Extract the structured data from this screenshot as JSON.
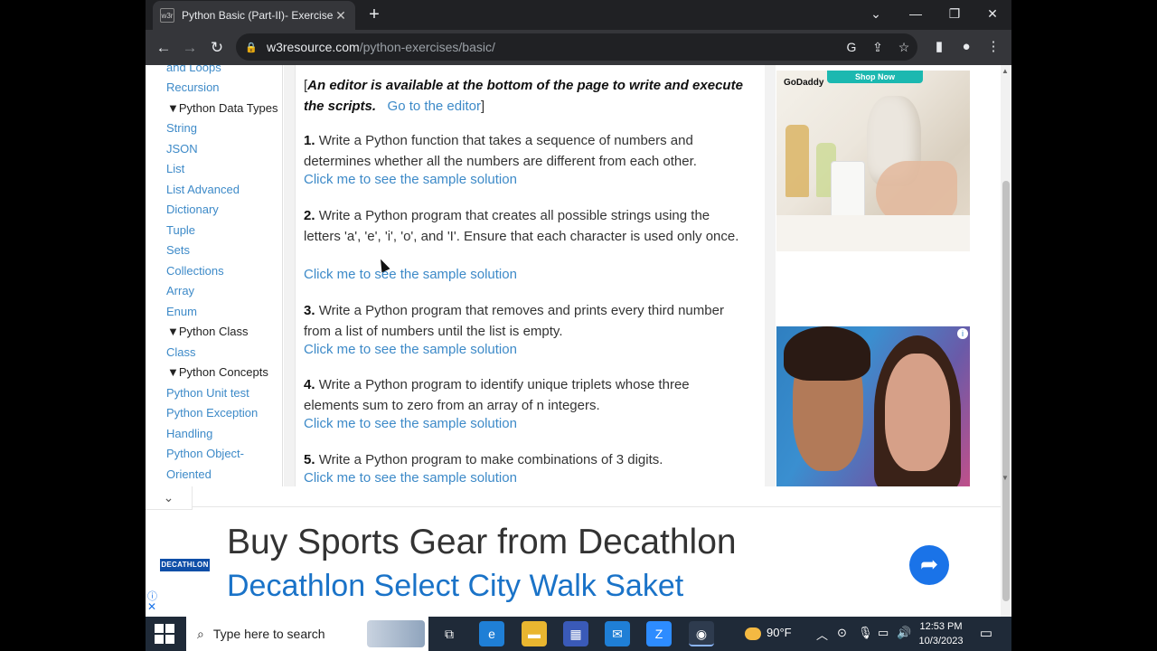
{
  "browser": {
    "tab": {
      "favicon_text": "w3r",
      "title": "Python Basic (Part-II)- Exercises,",
      "close": "✕"
    },
    "new_tab": "+",
    "window": {
      "dropdown": "⌄",
      "minimize": "—",
      "restore": "❐",
      "close": "✕"
    },
    "nav": {
      "back": "←",
      "forward": "→",
      "reload": "↻"
    },
    "address": {
      "host": "w3resource.com",
      "path": "/python-exercises/basic/"
    }
  },
  "sidebar": {
    "partial_top": "and Loops",
    "items": [
      {
        "label": "Recursion",
        "type": "link"
      },
      {
        "label": "▼Python Data Types",
        "type": "head"
      },
      {
        "label": "String",
        "type": "link"
      },
      {
        "label": "JSON",
        "type": "link"
      },
      {
        "label": "List",
        "type": "link"
      },
      {
        "label": "List Advanced",
        "type": "link"
      },
      {
        "label": "Dictionary",
        "type": "link"
      },
      {
        "label": "Tuple",
        "type": "link"
      },
      {
        "label": "Sets",
        "type": "link"
      },
      {
        "label": "Collections",
        "type": "link"
      },
      {
        "label": "Array",
        "type": "link"
      },
      {
        "label": "Enum",
        "type": "link"
      },
      {
        "label": "▼Python Class",
        "type": "head"
      },
      {
        "label": "Class",
        "type": "link"
      },
      {
        "label": "▼Python Concepts",
        "type": "head"
      },
      {
        "label": "Python Unit test",
        "type": "link"
      },
      {
        "label": "Python Exception",
        "type": "link"
      },
      {
        "label": "Handling",
        "type": "link"
      },
      {
        "label": "Python Object-",
        "type": "link"
      },
      {
        "label": "Oriented",
        "type": "link"
      }
    ]
  },
  "article": {
    "intro_open": "[",
    "intro_bold": "An editor is available at the bottom of the page to write and execute the scripts.",
    "intro_link": "Go to the editor",
    "intro_close": "]",
    "solution_label": "Click me to see the sample solution",
    "exercises": [
      {
        "num": "1.",
        "text": "Write a Python function that takes a sequence of numbers and determines whether all the numbers are different from each other."
      },
      {
        "num": "2.",
        "text": "Write a Python program that creates all possible strings using the letters 'a', 'e', 'i', 'o', and 'I'. Ensure that each character is used only once."
      },
      {
        "num": "3.",
        "text": "Write a Python program that removes and prints every third number from a list of numbers until the list is empty."
      },
      {
        "num": "4.",
        "text": "Write a Python program to identify unique triplets whose three elements sum to zero from an array of n integers."
      },
      {
        "num": "5.",
        "text": "Write a Python program to make combinations of 3 digits."
      }
    ],
    "back_to_top": "↑"
  },
  "ads": {
    "side_top": {
      "button": "Shop Now",
      "brand": "GoDaddy"
    },
    "side_bottom": {
      "info": "i"
    },
    "bottom": {
      "collapse": "⌄",
      "logo": "DECATHLON",
      "headline": "Buy Sports Gear from Decathlon",
      "subline": "Decathlon Select City Walk Saket",
      "go": "➦",
      "info": "ⓘ",
      "close": "✕"
    }
  },
  "taskbar": {
    "search_placeholder": "Type here to search",
    "weather": "90°F",
    "time": "12:53 PM",
    "date": "10/3/2023",
    "apps": [
      {
        "name": "task-view",
        "glyph": "⧉"
      },
      {
        "name": "edge",
        "glyph": "e"
      },
      {
        "name": "file-explorer",
        "glyph": "▬"
      },
      {
        "name": "store",
        "glyph": "▦"
      },
      {
        "name": "mail",
        "glyph": "✉"
      },
      {
        "name": "zoom",
        "glyph": "Z"
      },
      {
        "name": "chrome",
        "glyph": "◉"
      }
    ]
  },
  "colors": {
    "link": "#3d8ac8",
    "chrome_dark": "#202124",
    "taskbar": "#1f2a38",
    "accent": "#1a73e8"
  }
}
